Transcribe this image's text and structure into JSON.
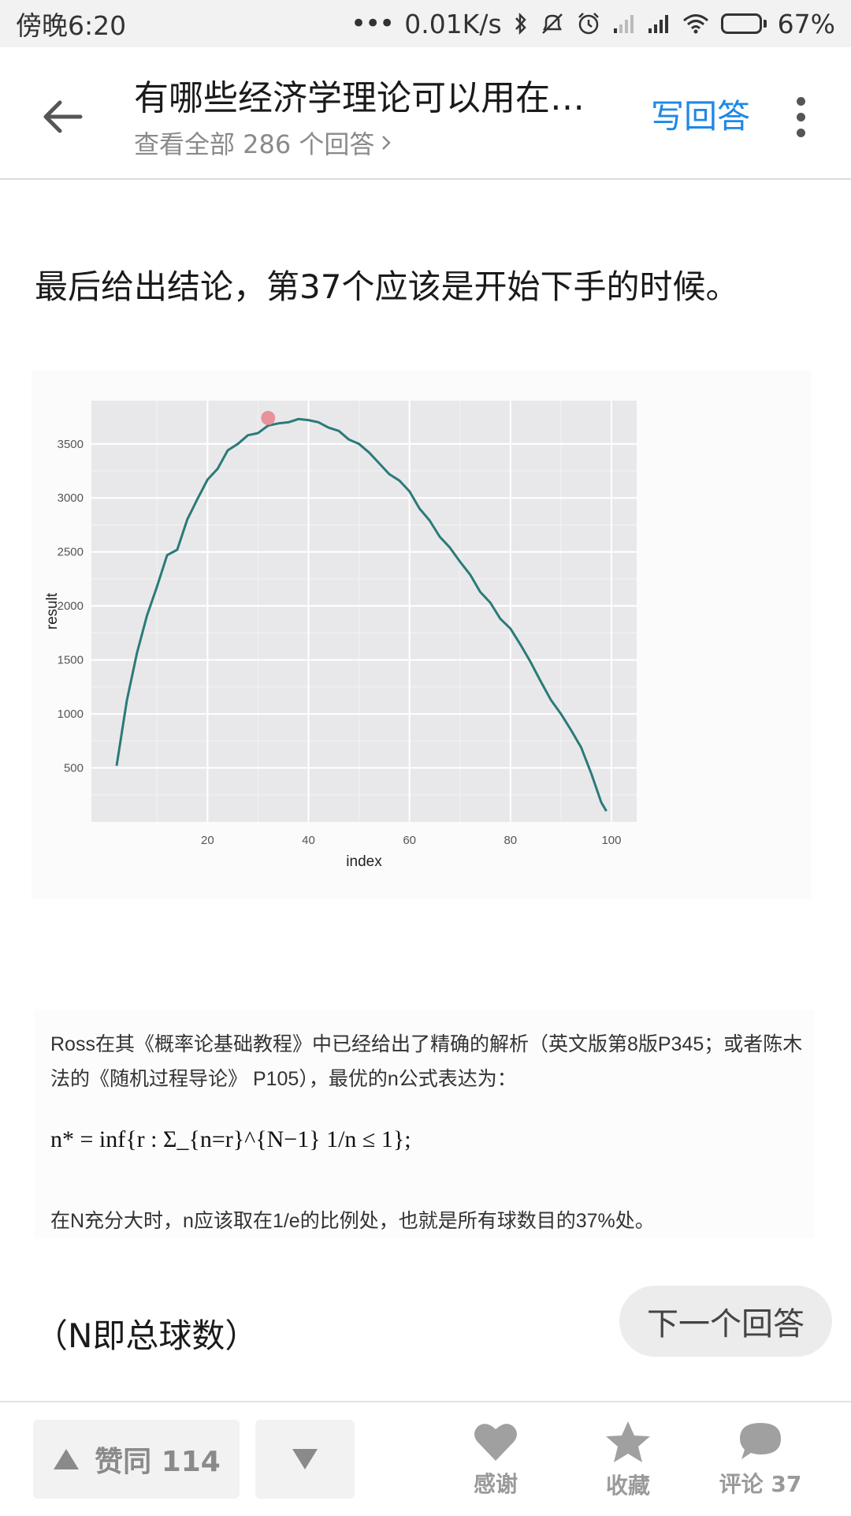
{
  "status_bar": {
    "time": "傍晚6:20",
    "network_speed": "0.01K/s",
    "battery": "67%",
    "battery_level": 0.67,
    "icons": [
      "dots-icon",
      "bluetooth-icon",
      "mute-icon",
      "alarm-icon",
      "signal-icon",
      "signal-icon",
      "wifi-icon",
      "battery-icon"
    ]
  },
  "header": {
    "title": "有哪些经济学理论可以用在…",
    "subtitle": "查看全部 286 个回答",
    "write_answer": "写回答",
    "icons": [
      "back-arrow-icon",
      "chevron-right-icon",
      "more-vertical-icon"
    ]
  },
  "content": {
    "conclusion": "最后给出结论，第37个应该是开始下手的时候。",
    "note": "（N即总球数）"
  },
  "formula_image": {
    "ross_text": "Ross在其《概率论基础教程》中已经给出了精确的解析（英文版第8版P345；或者陈木法的《随机过程导论》 P105），最优的n公式表达为：",
    "formula": "n* = inf{r : Σ_{n=r}^{N−1} 1/n ≤ 1};",
    "ratio_text": "在N充分大时，n应该取在1/e的比例处，也就是所有球数目的37%处。"
  },
  "chart_data": {
    "type": "line",
    "xlabel": "index",
    "ylabel": "result",
    "x_ticks": [
      20,
      40,
      60,
      80,
      100
    ],
    "y_ticks": [
      500,
      1000,
      1500,
      2000,
      2500,
      3000,
      3500
    ],
    "xlim": [
      -3,
      105
    ],
    "ylim": [
      0,
      3900
    ],
    "grid": true,
    "highlight_point": {
      "x": 32,
      "y": 3740
    },
    "series": [
      {
        "x": [
          2,
          4,
          6,
          8,
          10,
          12,
          14,
          16,
          18,
          20,
          22,
          24,
          26,
          28,
          30,
          32,
          34,
          36,
          38,
          40,
          42,
          44,
          46,
          48,
          50,
          52,
          54,
          56,
          58,
          60,
          62,
          64,
          66,
          68,
          70,
          72,
          74,
          76,
          78,
          80,
          82,
          84,
          86,
          88,
          90,
          92,
          94,
          96,
          98,
          99
        ],
        "values": [
          520,
          1120,
          1560,
          1910,
          2180,
          2470,
          2520,
          2800,
          2990,
          3170,
          3270,
          3440,
          3500,
          3580,
          3600,
          3670,
          3690,
          3700,
          3730,
          3720,
          3700,
          3650,
          3620,
          3540,
          3500,
          3420,
          3320,
          3220,
          3160,
          3060,
          2900,
          2790,
          2640,
          2540,
          2410,
          2290,
          2130,
          2030,
          1880,
          1790,
          1640,
          1480,
          1300,
          1130,
          1000,
          850,
          690,
          450,
          180,
          100
        ]
      }
    ],
    "colors": {
      "line": "#2b7a78",
      "highlight": "#e88a92",
      "panel": "#e8e8ea",
      "grid": "#ffffff"
    }
  },
  "next_answer": "下一个回答",
  "bottom_bar": {
    "upvote": "赞同 114",
    "thanks": "感谢",
    "collect": "收藏",
    "comment": "评论 37",
    "icons": [
      "triangle-up-icon",
      "triangle-down-icon",
      "heart-icon",
      "star-icon",
      "comment-bubble-icon"
    ]
  }
}
